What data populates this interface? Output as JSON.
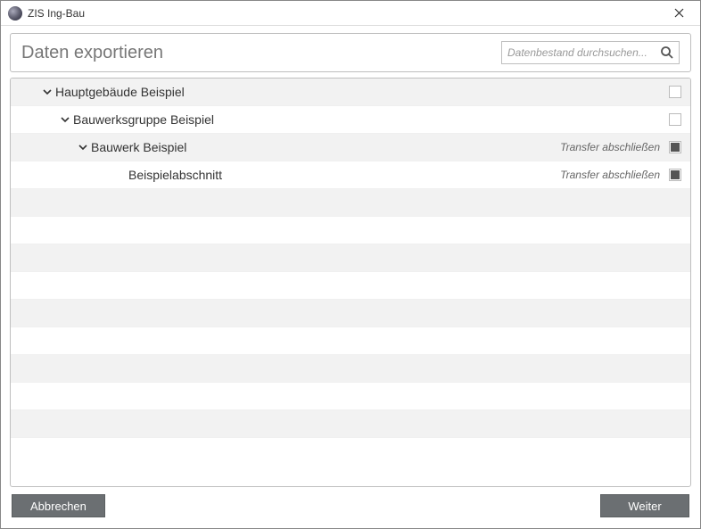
{
  "window": {
    "title": "ZIS Ing-Bau"
  },
  "header": {
    "title": "Daten exportieren",
    "search_placeholder": "Datenbestand durchsuchen..."
  },
  "tree": {
    "rows": [
      {
        "label": "Hauptgebäude Beispiel",
        "indent": 0,
        "chevron": true,
        "status": "",
        "check": "empty"
      },
      {
        "label": "Bauwerksgruppe Beispiel",
        "indent": 1,
        "chevron": true,
        "status": "",
        "check": "empty"
      },
      {
        "label": "Bauwerk Beispiel",
        "indent": 2,
        "chevron": true,
        "status": "Transfer abschließen",
        "check": "filled"
      },
      {
        "label": "Beispielabschnitt",
        "indent": 3,
        "chevron": false,
        "status": "Transfer abschließen",
        "check": "filled"
      }
    ],
    "empty_rows": 9
  },
  "footer": {
    "cancel": "Abbrechen",
    "next": "Weiter"
  }
}
